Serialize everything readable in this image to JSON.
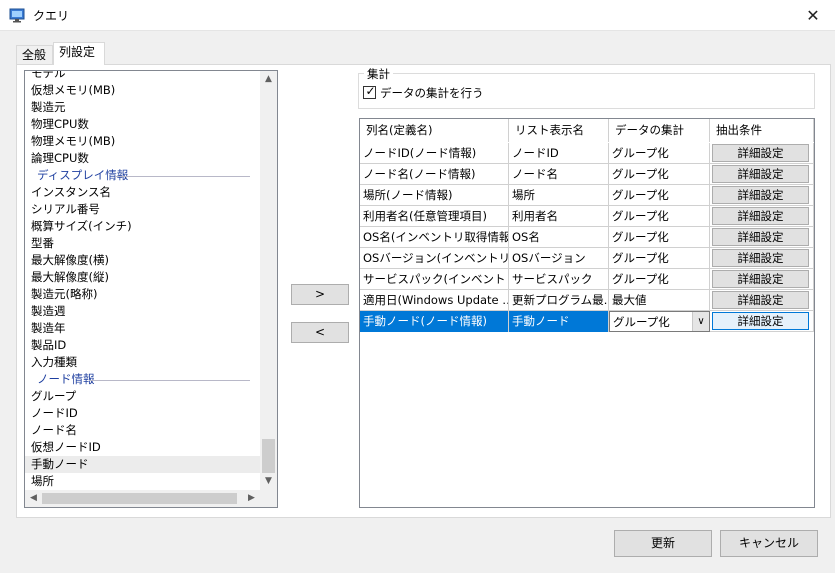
{
  "window": {
    "title": "クエリ",
    "close_glyph": "✕",
    "icon": "monitor-icon"
  },
  "tabs": [
    {
      "label": "全般"
    },
    {
      "label": "列設定"
    }
  ],
  "left_list": {
    "items": [
      {
        "kind": "item",
        "label": "モデル"
      },
      {
        "kind": "item",
        "label": "仮想メモリ(MB)"
      },
      {
        "kind": "item",
        "label": "製造元"
      },
      {
        "kind": "item",
        "label": "物理CPU数"
      },
      {
        "kind": "item",
        "label": "物理メモリ(MB)"
      },
      {
        "kind": "item",
        "label": "論理CPU数"
      },
      {
        "kind": "header",
        "label": "ディスプレイ情報"
      },
      {
        "kind": "item",
        "label": "インスタンス名"
      },
      {
        "kind": "item",
        "label": "シリアル番号"
      },
      {
        "kind": "item",
        "label": "概算サイズ(インチ)"
      },
      {
        "kind": "item",
        "label": "型番"
      },
      {
        "kind": "item",
        "label": "最大解像度(横)"
      },
      {
        "kind": "item",
        "label": "最大解像度(縦)"
      },
      {
        "kind": "item",
        "label": "製造元(略称)"
      },
      {
        "kind": "item",
        "label": "製造週"
      },
      {
        "kind": "item",
        "label": "製造年"
      },
      {
        "kind": "item",
        "label": "製品ID"
      },
      {
        "kind": "item",
        "label": "入力種類"
      },
      {
        "kind": "header",
        "label": "ノード情報"
      },
      {
        "kind": "item",
        "label": "グループ"
      },
      {
        "kind": "item",
        "label": "ノードID"
      },
      {
        "kind": "item",
        "label": "ノード名"
      },
      {
        "kind": "item",
        "label": "仮想ノードID"
      },
      {
        "kind": "item",
        "label": "手動ノード",
        "selected": true
      },
      {
        "kind": "item",
        "label": "場所"
      }
    ]
  },
  "move_buttons": {
    "add": ">",
    "remove": "<"
  },
  "aggregate": {
    "legend": "集計",
    "checkbox_label": "データの集計を行う",
    "checked": true
  },
  "grid": {
    "columns": [
      "列名(定義名)",
      "リスト表示名",
      "データの集計",
      "抽出条件"
    ],
    "detail_label": "詳細設定",
    "rows": [
      {
        "name": "ノードID(ノード情報)",
        "display": "ノードID",
        "agg": "グループ化"
      },
      {
        "name": "ノード名(ノード情報)",
        "display": "ノード名",
        "agg": "グループ化"
      },
      {
        "name": "場所(ノード情報)",
        "display": "場所",
        "agg": "グループ化"
      },
      {
        "name": "利用者名(任意管理項目)",
        "display": "利用者名",
        "agg": "グループ化"
      },
      {
        "name": "OS名(インベントリ取得情報)",
        "display": "OS名",
        "agg": "グループ化"
      },
      {
        "name": "OSバージョン(インベントリ取…",
        "display": "OSバージョン",
        "agg": "グループ化"
      },
      {
        "name": "サービスパック(インベントリ取…",
        "display": "サービスパック",
        "agg": "グループ化"
      },
      {
        "name": "適用日(Windows Update …",
        "display": "更新プログラム最…",
        "agg": "最大値"
      },
      {
        "name": "手動ノード(ノード情報)",
        "display": "手動ノード",
        "agg": "グループ化",
        "selected": true
      }
    ]
  },
  "footer": {
    "update": "更新",
    "cancel": "キャンセル"
  },
  "colors": {
    "selection": "#0078d7",
    "section_header": "#1e3fa0"
  }
}
